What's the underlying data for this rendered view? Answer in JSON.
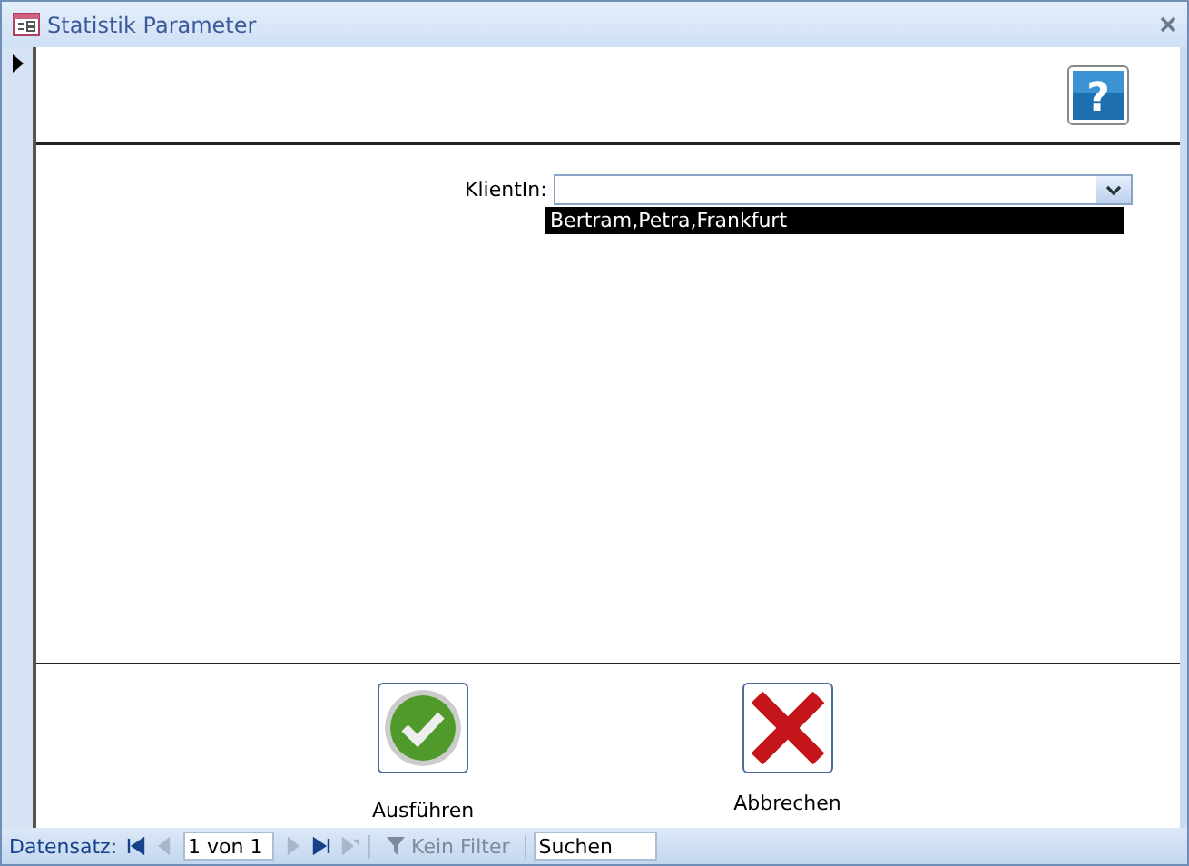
{
  "window": {
    "title": "Statistik Parameter"
  },
  "form": {
    "help_button": {
      "glyph": "?"
    },
    "field": {
      "label": "KlientIn:",
      "dropdown_items": [
        {
          "text": "Bertram,Petra,Frankfurt",
          "selected": true
        }
      ]
    },
    "buttons": [
      {
        "kind": "run",
        "label": "Ausführen"
      },
      {
        "kind": "cancel",
        "label": "Abbrechen"
      }
    ]
  },
  "status_bar": {
    "record_label": "Datensatz:",
    "record_position": "1 von 1",
    "nav": [
      {
        "kind": "first",
        "disabled": false
      },
      {
        "kind": "prev",
        "disabled": true
      },
      {
        "kind": "next",
        "disabled": true
      },
      {
        "kind": "last",
        "disabled": false
      },
      {
        "kind": "new",
        "disabled": true
      }
    ],
    "filter": {
      "label": "Kein Filter",
      "disabled": true
    },
    "search": {
      "placeholder": "Suchen"
    }
  }
}
